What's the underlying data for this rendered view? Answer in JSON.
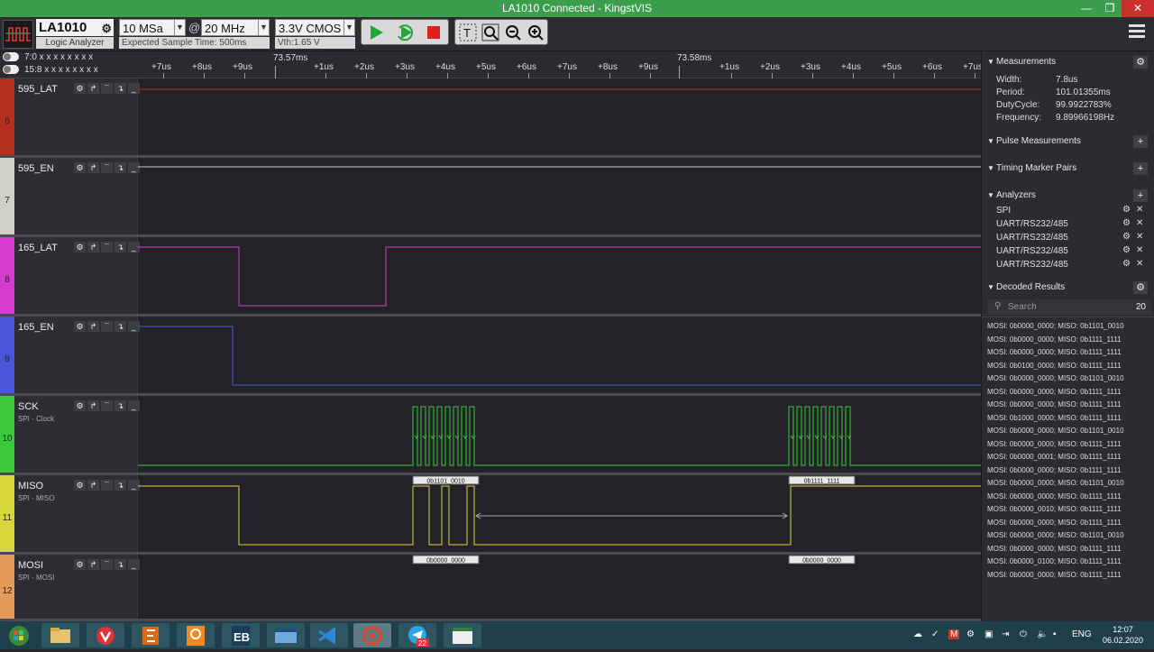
{
  "window": {
    "title": "LA1010 Connected - KingstVIS"
  },
  "toolbar": {
    "device": "LA1010",
    "device_sub": "Logic Analyzer",
    "sample_depth": "10 MSa",
    "at": "@",
    "sample_rate": "20 MHz",
    "expected_time": "Expected Sample Time: 500ms",
    "threshold": "3.3V CMOS",
    "vth": "Vth:1.65 V"
  },
  "timebar": {
    "mask_rows": [
      "7:0  x x x x x x x x",
      "15:8  x x x x x x x x"
    ],
    "major": [
      "73.57ms",
      "73.58ms"
    ],
    "ticks": [
      "+7us",
      "+8us",
      "+9us",
      "+1us",
      "+2us",
      "+3us",
      "+4us",
      "+5us",
      "+6us",
      "+7us",
      "+8us",
      "+9us",
      "+1us",
      "+2us",
      "+3us",
      "+4us",
      "+5us",
      "+6us",
      "+7us"
    ]
  },
  "channels": [
    {
      "num": "6",
      "name": "595_LAT",
      "sub": "",
      "color": "#b5301c"
    },
    {
      "num": "7",
      "name": "595_EN",
      "sub": "",
      "color": "#d0d0c4"
    },
    {
      "num": "8",
      "name": "165_LAT",
      "sub": "",
      "color": "#d63ccf"
    },
    {
      "num": "9",
      "name": "165_EN",
      "sub": "",
      "color": "#4a55d8"
    },
    {
      "num": "10",
      "name": "SCK",
      "sub": "SPI - Clock",
      "color": "#3cc83c"
    },
    {
      "num": "11",
      "name": "MISO",
      "sub": "SPI - MISO",
      "color": "#d8d83c"
    },
    {
      "num": "12",
      "name": "MOSI",
      "sub": "SPI - MOSI",
      "color": "#e69a5a"
    }
  ],
  "decode_labels": {
    "miso_1": "0b1101_0010",
    "miso_2": "0b1111_1111",
    "mosi_1": "0b0000_0000",
    "mosi_2": "0b0000_0000"
  },
  "measurements": {
    "title": "Measurements",
    "rows": [
      {
        "k": "Width:",
        "v": "7.8us"
      },
      {
        "k": "Period:",
        "v": "101.01355ms"
      },
      {
        "k": "DutyCycle:",
        "v": "99.9922783%"
      },
      {
        "k": "Frequency:",
        "v": "9.89966198Hz"
      }
    ]
  },
  "panels": {
    "pulse": "Pulse Measurements",
    "timing": "Timing Marker Pairs",
    "analyzers": "Analyzers",
    "decoded": "Decoded Results"
  },
  "analyzers": [
    "SPI",
    "UART/RS232/485",
    "UART/RS232/485",
    "UART/RS232/485",
    "UART/RS232/485"
  ],
  "search": {
    "placeholder": "Search",
    "count": "20"
  },
  "decoded": [
    "MOSI: 0b0000_0000;  MISO: 0b1101_0010",
    "MOSI: 0b0000_0000;  MISO: 0b1111_1111",
    "MOSI: 0b0000_0000;  MISO: 0b1111_1111",
    "MOSI: 0b0100_0000;  MISO: 0b1111_1111",
    "MOSI: 0b0000_0000;  MISO: 0b1101_0010",
    "MOSI: 0b0000_0000;  MISO: 0b1111_1111",
    "MOSI: 0b0000_0000;  MISO: 0b1111_1111",
    "MOSI: 0b1000_0000;  MISO: 0b1111_1111",
    "MOSI: 0b0000_0000;  MISO: 0b1101_0010",
    "MOSI: 0b0000_0000;  MISO: 0b1111_1111",
    "MOSI: 0b0000_0001;  MISO: 0b1111_1111",
    "MOSI: 0b0000_0000;  MISO: 0b1111_1111",
    "MOSI: 0b0000_0000;  MISO: 0b1101_0010",
    "MOSI: 0b0000_0000;  MISO: 0b1111_1111",
    "MOSI: 0b0000_0010;  MISO: 0b1111_1111",
    "MOSI: 0b0000_0000;  MISO: 0b1111_1111",
    "MOSI: 0b0000_0000;  MISO: 0b1101_0010",
    "MOSI: 0b0000_0000;  MISO: 0b1111_1111",
    "MOSI: 0b0000_0100;  MISO: 0b1111_1111",
    "MOSI: 0b0000_0000;  MISO: 0b1111_1111"
  ],
  "taskbar": {
    "lang": "ENG",
    "time": "12:07",
    "date": "06.02.2020",
    "telegram_badge": "22"
  }
}
